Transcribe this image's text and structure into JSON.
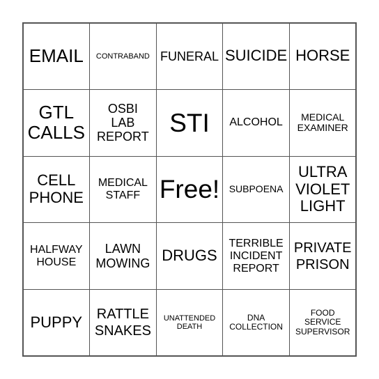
{
  "board": {
    "free_label": "Free!",
    "rows": [
      [
        {
          "text": "EMAIL",
          "size": "s-lg"
        },
        {
          "text": "CONTRABAND",
          "size": "s-micro"
        },
        {
          "text": "FUNERAL",
          "size": "s-sm"
        },
        {
          "text": "SUICIDE",
          "size": "s-ml"
        },
        {
          "text": "HORSE",
          "size": "s-ml"
        }
      ],
      [
        {
          "text": "GTL\nCALLS",
          "size": "s-lg"
        },
        {
          "text": "OSBI\nLAB\nREPORT",
          "size": "s-sm"
        },
        {
          "text": "STI",
          "size": "s-xl"
        },
        {
          "text": "ALCOHOL",
          "size": "s-xs"
        },
        {
          "text": "MEDICAL\nEXAMINER",
          "size": "s-xxs"
        }
      ],
      [
        {
          "text": "CELL\nPHONE",
          "size": "s-ml"
        },
        {
          "text": "MEDICAL\nSTAFF",
          "size": "s-xs"
        },
        {
          "text": "Free!",
          "size": "s-xl"
        },
        {
          "text": "SUBPOENA",
          "size": "s-xxs"
        },
        {
          "text": "ULTRA\nVIOLET\nLIGHT",
          "size": "s-ml"
        }
      ],
      [
        {
          "text": "HALFWAY\nHOUSE",
          "size": "s-xs"
        },
        {
          "text": "LAWN\nMOWING",
          "size": "s-sm"
        },
        {
          "text": "DRUGS",
          "size": "s-ml"
        },
        {
          "text": "TERRIBLE\nINCIDENT\nREPORT",
          "size": "s-xs"
        },
        {
          "text": "PRIVATE\nPRISON",
          "size": "s-md"
        }
      ],
      [
        {
          "text": "PUPPY",
          "size": "s-ml"
        },
        {
          "text": "RATTLE\nSNAKES",
          "size": "s-md"
        },
        {
          "text": "UNATTENDED\nDEATH",
          "size": "s-micro"
        },
        {
          "text": "DNA\nCOLLECTION",
          "size": "s-tiny"
        },
        {
          "text": "FOOD\nSERVICE\nSUPERVISOR",
          "size": "s-tiny"
        }
      ]
    ]
  }
}
